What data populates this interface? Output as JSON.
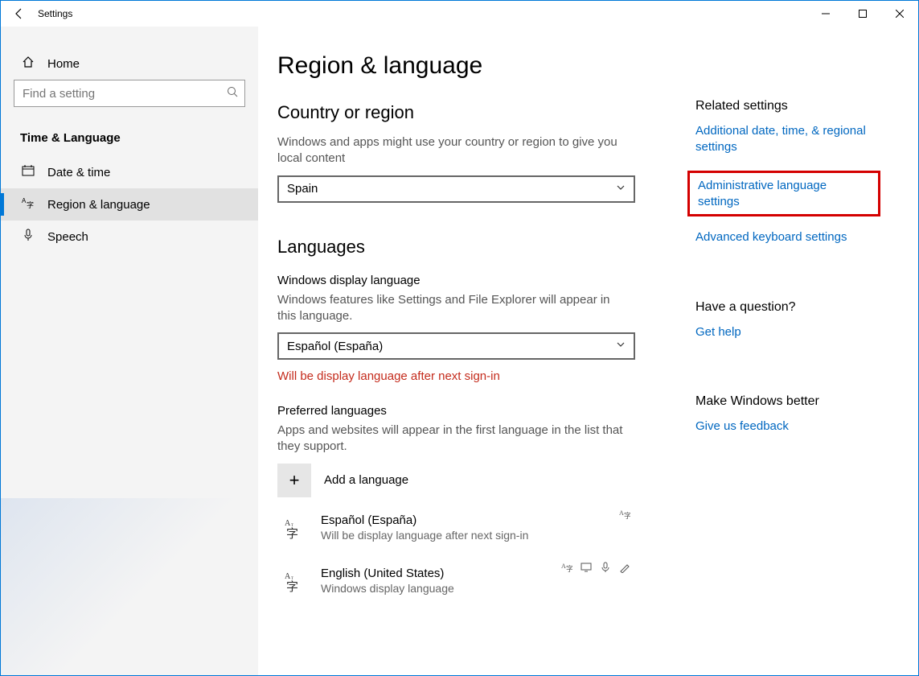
{
  "titlebar": {
    "title": "Settings"
  },
  "sidebar": {
    "home_label": "Home",
    "search_placeholder": "Find a setting",
    "group_label": "Time & Language",
    "items": [
      {
        "label": "Date & time"
      },
      {
        "label": "Region & language"
      },
      {
        "label": "Speech"
      }
    ]
  },
  "content": {
    "page_title": "Region & language",
    "country_section_title": "Country or region",
    "country_desc": "Windows and apps might use your country or region to give you local content",
    "country_value": "Spain",
    "languages_section_title": "Languages",
    "display_lang_label": "Windows display language",
    "display_lang_desc": "Windows features like Settings and File Explorer will appear in this language.",
    "display_lang_value": "Español (España)",
    "display_lang_warning": "Will be display language after next sign-in",
    "preferred_label": "Preferred languages",
    "preferred_desc": "Apps and websites will appear in the first language in the list that they support.",
    "add_language_label": "Add a language",
    "lang_entries": [
      {
        "name": "Español (España)",
        "sub": "Will be display language after next sign-in"
      },
      {
        "name": "English (United States)",
        "sub": "Windows display language"
      }
    ]
  },
  "rightpane": {
    "related_title": "Related settings",
    "link_additional": "Additional date, time, & regional settings",
    "link_admin": "Administrative language settings",
    "link_keyboard": "Advanced keyboard settings",
    "question_title": "Have a question?",
    "link_help": "Get help",
    "improve_title": "Make Windows better",
    "link_feedback": "Give us feedback"
  }
}
